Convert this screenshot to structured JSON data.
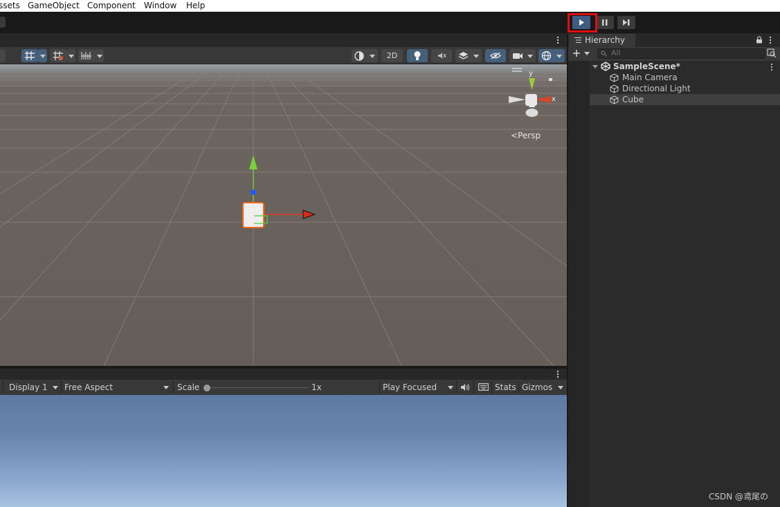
{
  "menu": {
    "items": [
      "ssets",
      "GameObject",
      "Component",
      "Window",
      "Help"
    ]
  },
  "toolbar": {
    "play_icon": "play-icon",
    "pause_icon": "pause-icon",
    "step_icon": "step-icon",
    "play_active": true,
    "highlight_color": "#e01010"
  },
  "scene": {
    "toolbar": {
      "two_d_label": "2D"
    },
    "camera_mode": "Persp",
    "axis_y": "y",
    "axis_x": "x"
  },
  "game": {
    "display": "Display 1",
    "aspect": "Free Aspect",
    "scale_label": "Scale",
    "scale_value": "1x",
    "play_mode": "Play Focused",
    "stats": "Stats",
    "gizmos": "Gizmos"
  },
  "hierarchy": {
    "tab_label": "Hierarchy",
    "search_placeholder": "All",
    "scene": "SampleScene*",
    "objects": [
      "Main Camera",
      "Directional Light",
      "Cube"
    ],
    "selected": "Cube"
  },
  "watermark": "CSDN @鸢尾の",
  "colors": {
    "accent": "#3f5c80",
    "panel": "#383838",
    "scene_ground": "#655e58",
    "sky": "#6784ad"
  }
}
